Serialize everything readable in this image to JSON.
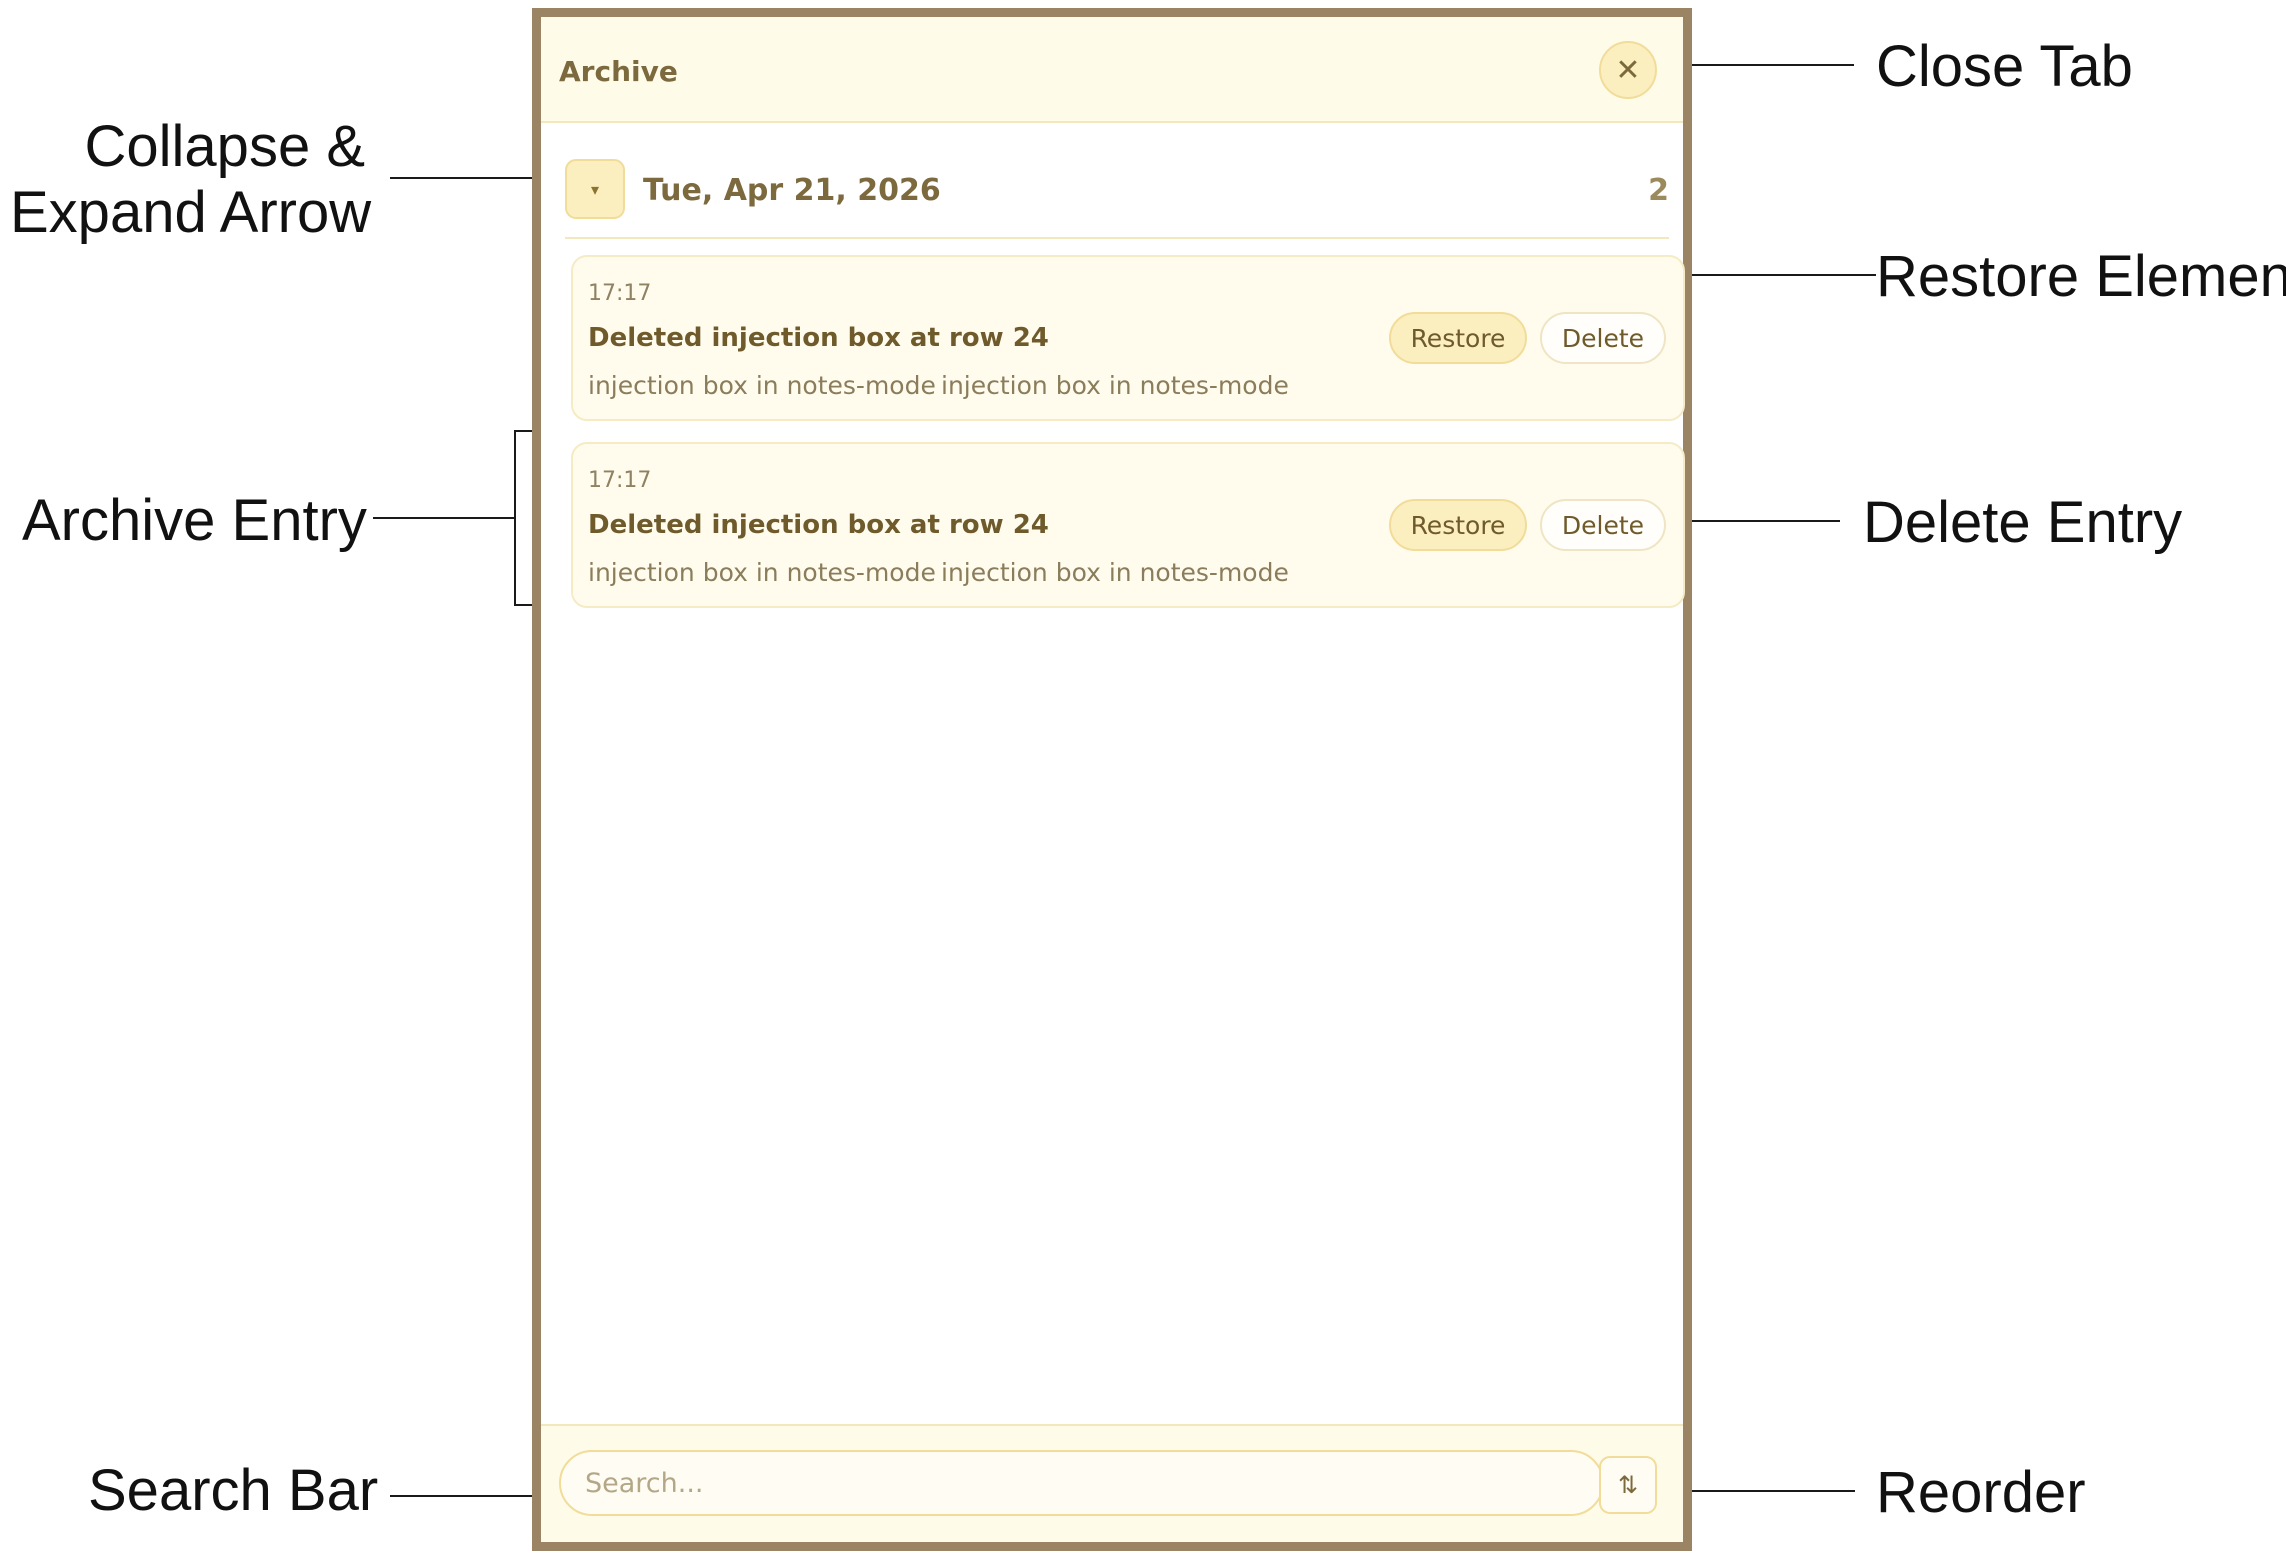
{
  "annotations": {
    "close_tab": "Close Tab",
    "collapse_line1": "Collapse &",
    "collapse_line2": "Expand Arrow",
    "restore_element": "Restore Element",
    "archive_entry": "Archive Entry",
    "delete_entry": "Delete Entry",
    "search_bar": "Search Bar",
    "reorder": "Reorder"
  },
  "panel": {
    "title": "Archive",
    "close_icon": "close-icon",
    "close_glyph": "✕"
  },
  "group": {
    "date": "Tue, Apr 21, 2026",
    "count": "2",
    "arrow_icon": "chevron-down-icon",
    "arrow_glyph": "▾"
  },
  "entries": [
    {
      "time": "17:17",
      "title": "Deleted injection box at row 24",
      "desc1": "injection box in notes-mode",
      "desc2": "injection box in notes-mode",
      "restore_label": "Restore",
      "delete_label": "Delete"
    },
    {
      "time": "17:17",
      "title": "Deleted injection box at row 24",
      "desc1": "injection box in notes-mode",
      "desc2": "injection box in notes-mode",
      "restore_label": "Restore",
      "delete_label": "Delete"
    }
  ],
  "footer": {
    "search_placeholder": "Search...",
    "search_value": "",
    "reorder_icon": "sort-icon",
    "reorder_glyph": "⇅"
  },
  "colors": {
    "panel_border": "#9a8464",
    "accent": "#fbefc0",
    "text_primary": "#6f5a2b",
    "background_tint": "#fffbe9"
  }
}
